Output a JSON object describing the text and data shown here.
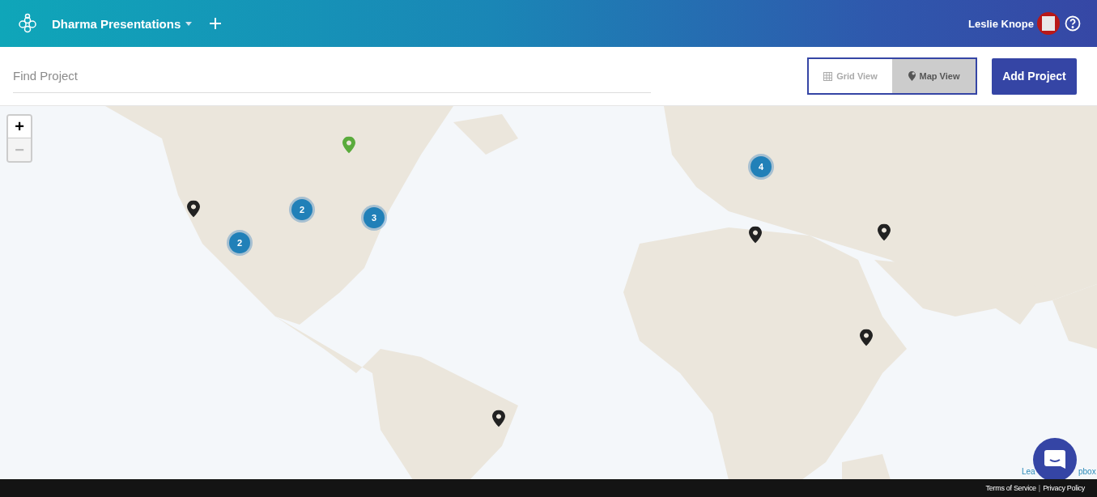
{
  "header": {
    "workspace": "Dharma Presentations",
    "user": "Leslie Knope"
  },
  "toolbar": {
    "search": {
      "placeholder": "Find Project"
    },
    "views": [
      {
        "label": "Grid View",
        "kind": "grid",
        "selected": false
      },
      {
        "label": "Map View",
        "kind": "map",
        "selected": true
      }
    ],
    "add_button": "Add Project"
  },
  "map": {
    "zoom": {
      "in": "+",
      "out": "−",
      "out_disabled": true
    },
    "markers": [
      {
        "kind": "pin",
        "color": "#5aab3c"
      },
      {
        "kind": "pin",
        "color": "#222222"
      },
      {
        "kind": "cluster",
        "count": "2"
      },
      {
        "kind": "cluster",
        "count": "3"
      },
      {
        "kind": "cluster",
        "count": "2"
      },
      {
        "kind": "cluster",
        "count": "4"
      },
      {
        "kind": "pin",
        "color": "#222222"
      },
      {
        "kind": "pin",
        "color": "#222222"
      },
      {
        "kind": "pin",
        "color": "#222222"
      },
      {
        "kind": "pin",
        "color": "#222222"
      }
    ],
    "attribution": [
      "Lea",
      "pbox"
    ]
  },
  "footer": {
    "links": [
      "Terms of Service",
      "Privacy Policy"
    ],
    "separator": "|"
  }
}
